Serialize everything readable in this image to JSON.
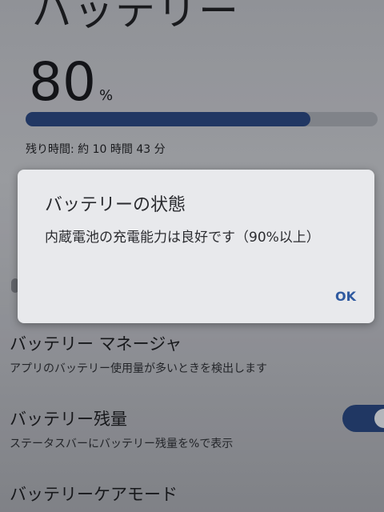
{
  "page": {
    "title": "バッテリー",
    "battery_percent": "80",
    "percent_unit": "%",
    "level_fraction": 0.81,
    "remaining_time": "残り時間: 約 10 時間 43 分"
  },
  "settings": [
    {
      "title": "バッテリー マネージャ",
      "description": "アプリのバッテリー使用量が多いときを検出します"
    },
    {
      "title": "バッテリー残量",
      "description": "ステータスバーにバッテリー残量を%で表示",
      "toggle_on": true
    },
    {
      "title": "バッテリーケアモード"
    }
  ],
  "dialog": {
    "title": "バッテリーの状態",
    "message": "内蔵電池の充電能力は良好です（90%以上）",
    "ok_label": "OK"
  },
  "colors": {
    "accent": "#203a6c",
    "dialog_button": "#2f5aa0"
  }
}
